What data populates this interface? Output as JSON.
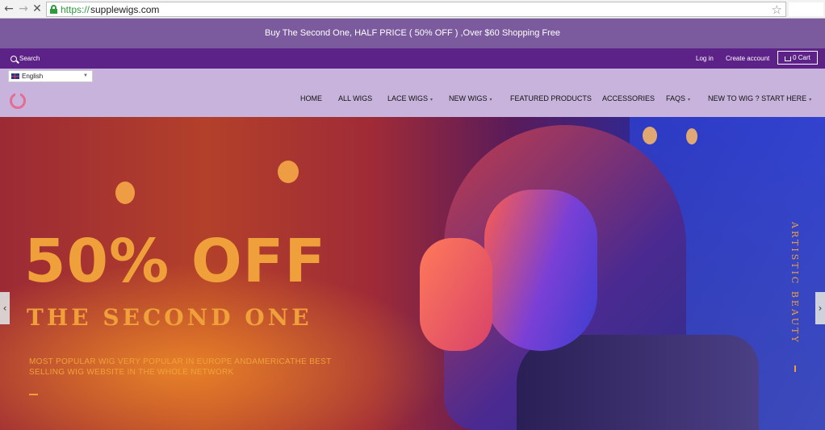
{
  "browser": {
    "url_scheme": "https://",
    "url_host": "supplewigs.com",
    "back_glyph": "←",
    "forward_glyph": "→",
    "stop_glyph": "✕",
    "bookmark_glyph": "☆"
  },
  "announcement": {
    "text": "Buy The Second One, HALF PRICE ( 50% OFF ) ,Over $60 Shopping Free"
  },
  "utility": {
    "search_label": "Search",
    "login_label": "Log in",
    "create_account_label": "Create account",
    "cart_label": "0 Cart"
  },
  "header": {
    "language": "English",
    "menu": [
      {
        "label": "HOME"
      },
      {
        "label": "ALL WIGS"
      },
      {
        "label": "LACE WIGS"
      },
      {
        "label": "NEW WIGS"
      },
      {
        "label": "FEATURED PRODUCTS"
      },
      {
        "label": "ACCESSORIES"
      },
      {
        "label": "FAQS"
      },
      {
        "label": "NEW TO WIG ? START HERE"
      }
    ],
    "dropdown_glyph": "▾"
  },
  "hero": {
    "headline": "50% OFF",
    "subheadline": "THE SECOND ONE",
    "description": "MOST POPULAR WIG VERY POPULAR IN EUROPE ANDAMERICATHE BEST SELLING WIG WEBSITE IN THE WHOLE NETWORK",
    "vertical_text": "ARTISTIC BEAUTY",
    "prev_glyph": "‹",
    "next_glyph": "›"
  },
  "colors": {
    "announcement_bg": "#7b5a9d",
    "utility_bg": "#5d2287",
    "header_bg": "#c8b3dc",
    "promo_text": "#f0a03a",
    "logo": "#e56d92"
  }
}
